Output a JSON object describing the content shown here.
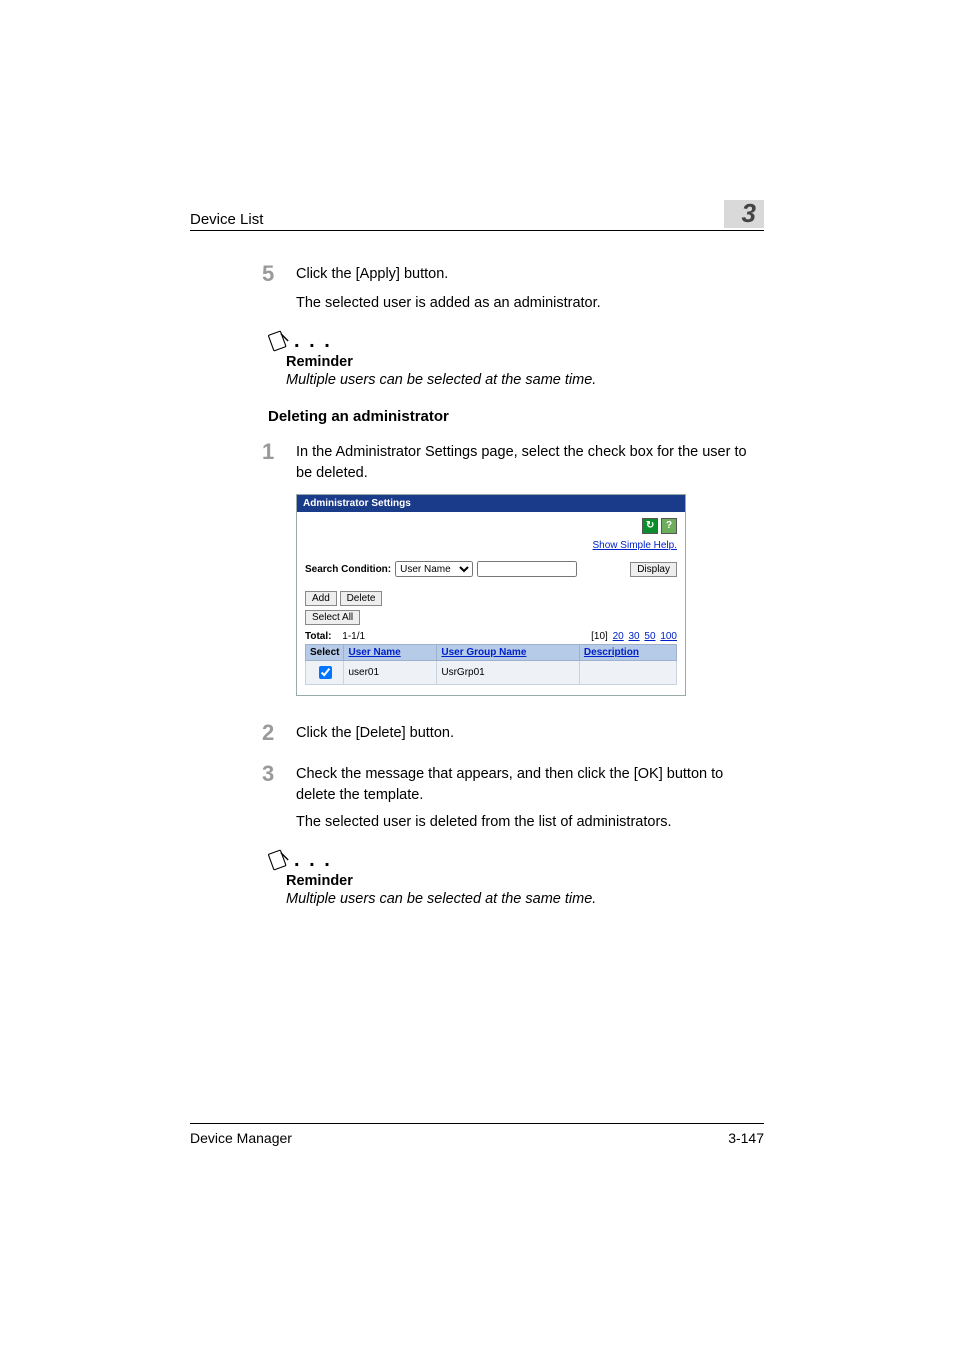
{
  "header": {
    "title": "Device List",
    "chapter": "3"
  },
  "step5": {
    "num": "5",
    "text": "Click the [Apply] button.",
    "sub": "The selected user is added as an administrator."
  },
  "note1": {
    "title": "Reminder",
    "body": "Multiple users can be selected at the same time."
  },
  "subheading": "Deleting an administrator",
  "step1": {
    "num": "1",
    "text": "In the Administrator Settings page, select the check box for the user to be deleted."
  },
  "panel": {
    "title": "Administrator Settings",
    "helplink": "Show Simple Help.",
    "search_label": "Search Condition:",
    "search_option": "User Name",
    "search_value": "",
    "display_btn": "Display",
    "add_btn": "Add",
    "delete_btn": "Delete",
    "selectall_btn": "Select All",
    "total_label": "Total:",
    "total_value": "1-1/1",
    "pager": {
      "cur": "[10]",
      "opts": [
        "20",
        "30",
        "50",
        "100"
      ]
    },
    "cols": {
      "select": "Select",
      "user": "User Name",
      "group": "User Group Name",
      "desc": "Description"
    },
    "rows": [
      {
        "checked": true,
        "user": "user01",
        "group": "UsrGrp01",
        "desc": ""
      }
    ]
  },
  "step2": {
    "num": "2",
    "text": "Click the [Delete] button."
  },
  "step3": {
    "num": "3",
    "text": "Check the message that appears, and then click the [OK] button to delete the template.",
    "sub": "The selected user is deleted from the list of administrators."
  },
  "note2": {
    "title": "Reminder",
    "body": "Multiple users can be selected at the same time."
  },
  "footer": {
    "left": "Device Manager",
    "right": "3-147"
  }
}
